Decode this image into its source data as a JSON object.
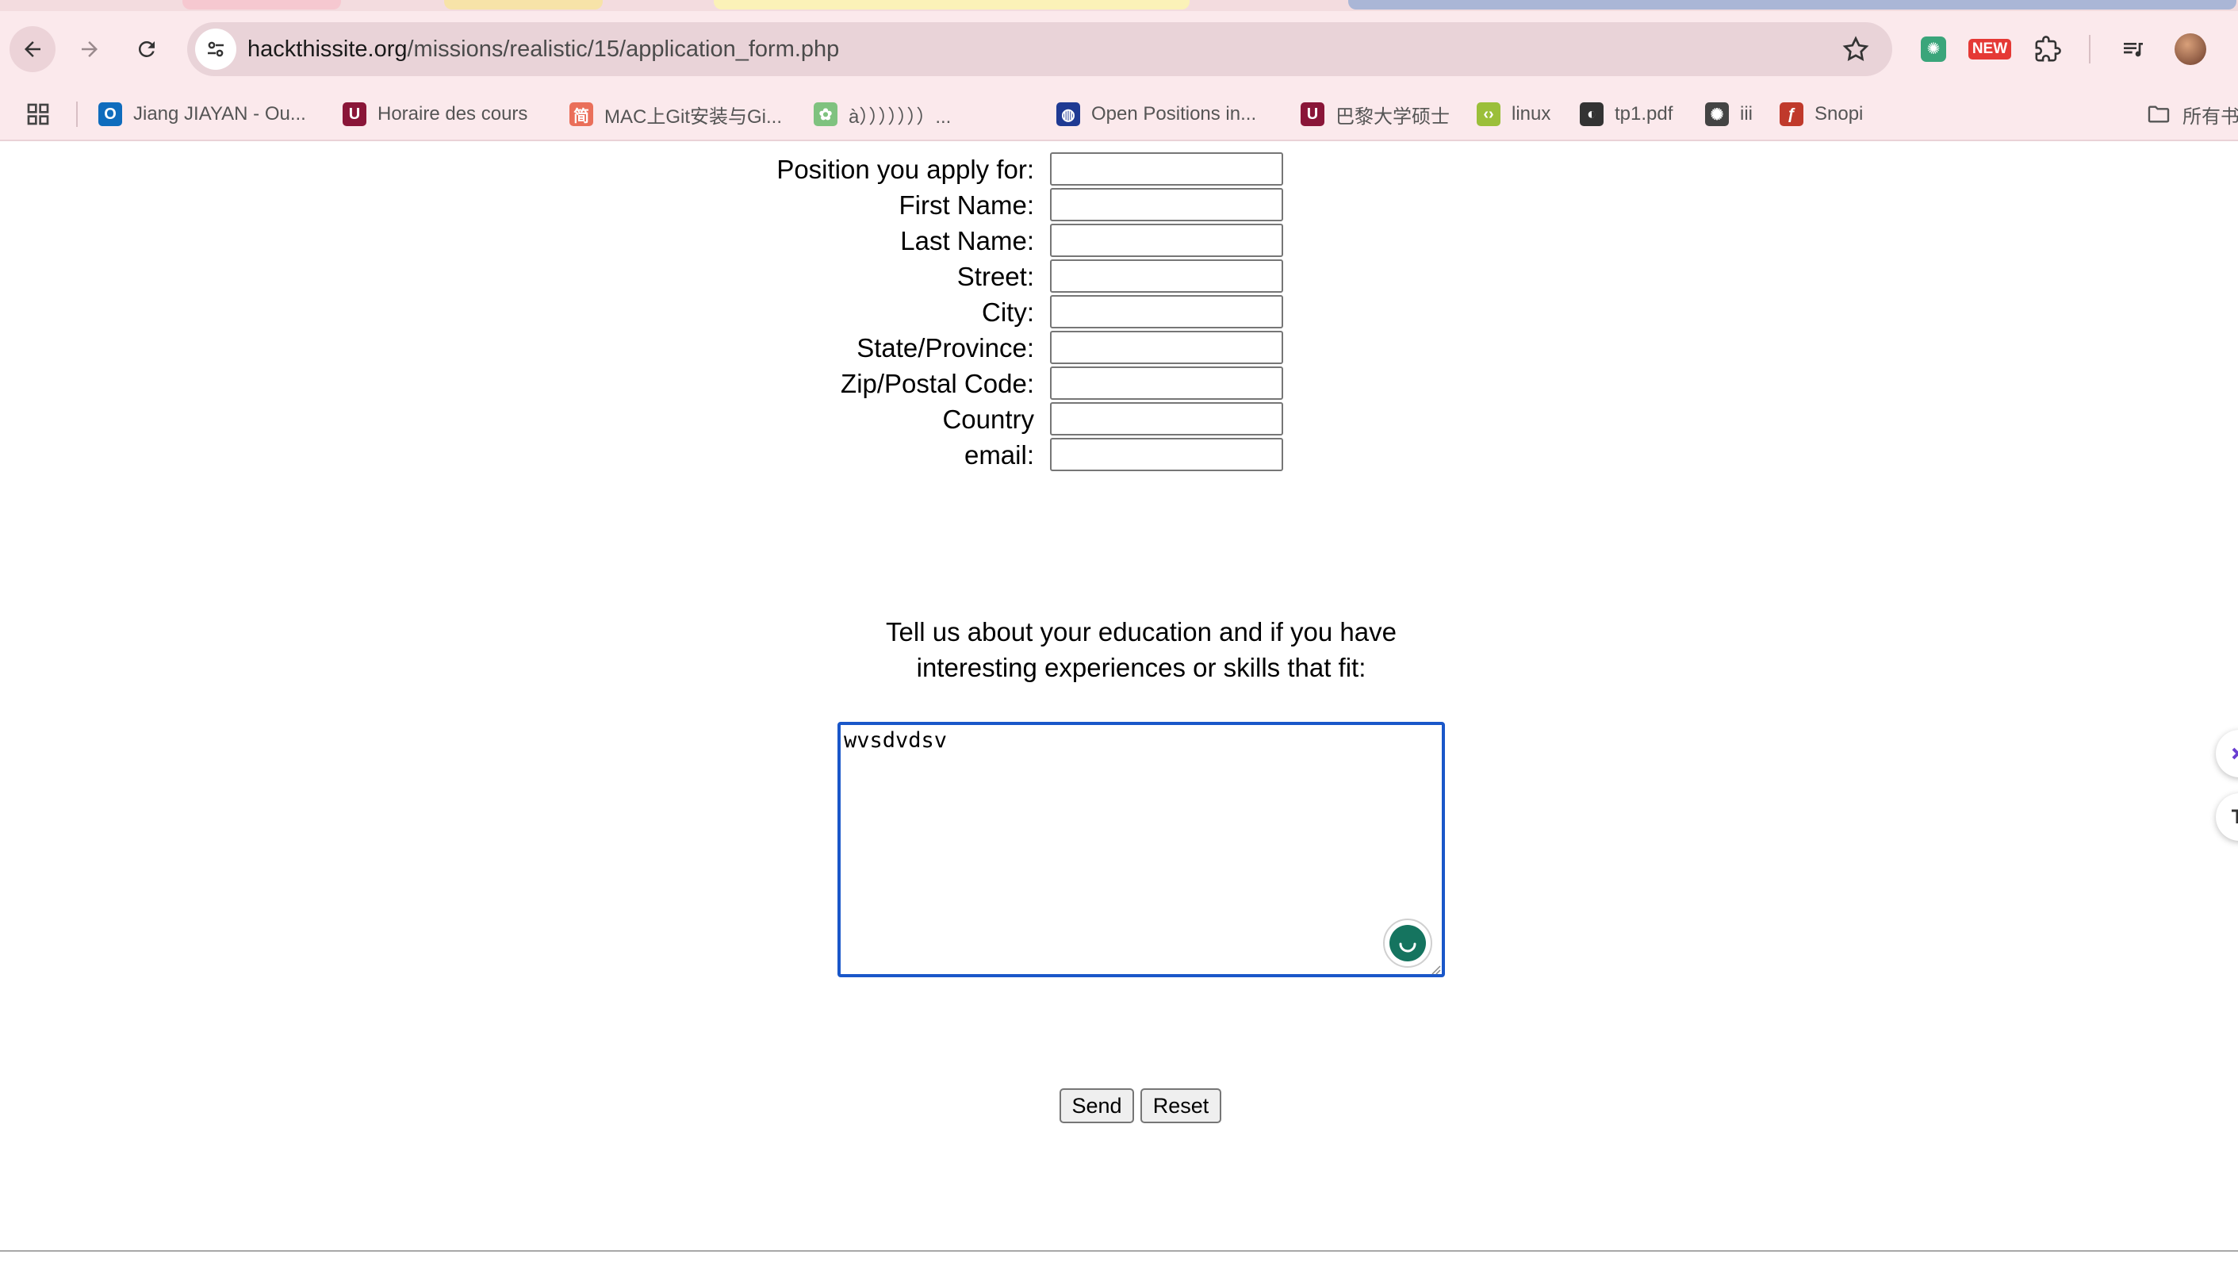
{
  "browser": {
    "url_host": "hackthissite.org",
    "url_path": "/missions/realistic/15/application_form.php",
    "ext_new_badge": "NEW",
    "bookmarks": [
      {
        "label": "Jiang JIAYAN - Ou...",
        "icon": "outlook-icon",
        "color": "#0f6cbd",
        "glyph": "O"
      },
      {
        "label": "Horaire des cours",
        "icon": "university-icon",
        "color": "#8a1538",
        "glyph": "U"
      },
      {
        "label": "MAC上Git安装与Gi...",
        "icon": "jianshu-icon",
        "color": "#ea6f5a",
        "glyph": "简"
      },
      {
        "label": "à）））））））...",
        "icon": "pawprint-icon",
        "color": "#7fc27f",
        "glyph": "✿"
      },
      {
        "label": "Open Positions in...",
        "icon": "globe-icon",
        "color": "#1f3a93",
        "glyph": "◍"
      },
      {
        "label": "巴黎大学硕士",
        "icon": "university-icon",
        "color": "#8a1538",
        "glyph": "U"
      },
      {
        "label": "linux",
        "icon": "code-icon",
        "color": "#9bbf3a",
        "glyph": "‹›"
      },
      {
        "label": "tp1.pdf",
        "icon": "globe-dark-icon",
        "color": "#333333",
        "glyph": "◐"
      },
      {
        "label": "iii",
        "icon": "openai-icon",
        "color": "#444444",
        "glyph": "✺"
      },
      {
        "label": "Snopi",
        "icon": "function-icon",
        "color": "#c0392b",
        "glyph": "ƒ"
      }
    ],
    "all_bookmarks_label": "所有书"
  },
  "form": {
    "fields": [
      {
        "label": "Position you apply for:",
        "value": ""
      },
      {
        "label": "First Name:",
        "value": ""
      },
      {
        "label": "Last Name:",
        "value": ""
      },
      {
        "label": "Street:",
        "value": ""
      },
      {
        "label": "City:",
        "value": ""
      },
      {
        "label": "State/Province:",
        "value": ""
      },
      {
        "label": "Zip/Postal Code:",
        "value": ""
      },
      {
        "label": "Country",
        "value": ""
      },
      {
        "label": "email:",
        "value": ""
      }
    ],
    "prompt_line1": "Tell us about your education and if you have",
    "prompt_line2": "interesting experiences or skills that fit:",
    "textarea_value": "wvsdvdsv",
    "send_label": "Send",
    "reset_label": "Reset"
  },
  "colors": {
    "focus_border": "#1a57c9",
    "chrome_bg": "#fbe9ec",
    "grammar_badge": "#15745f"
  }
}
